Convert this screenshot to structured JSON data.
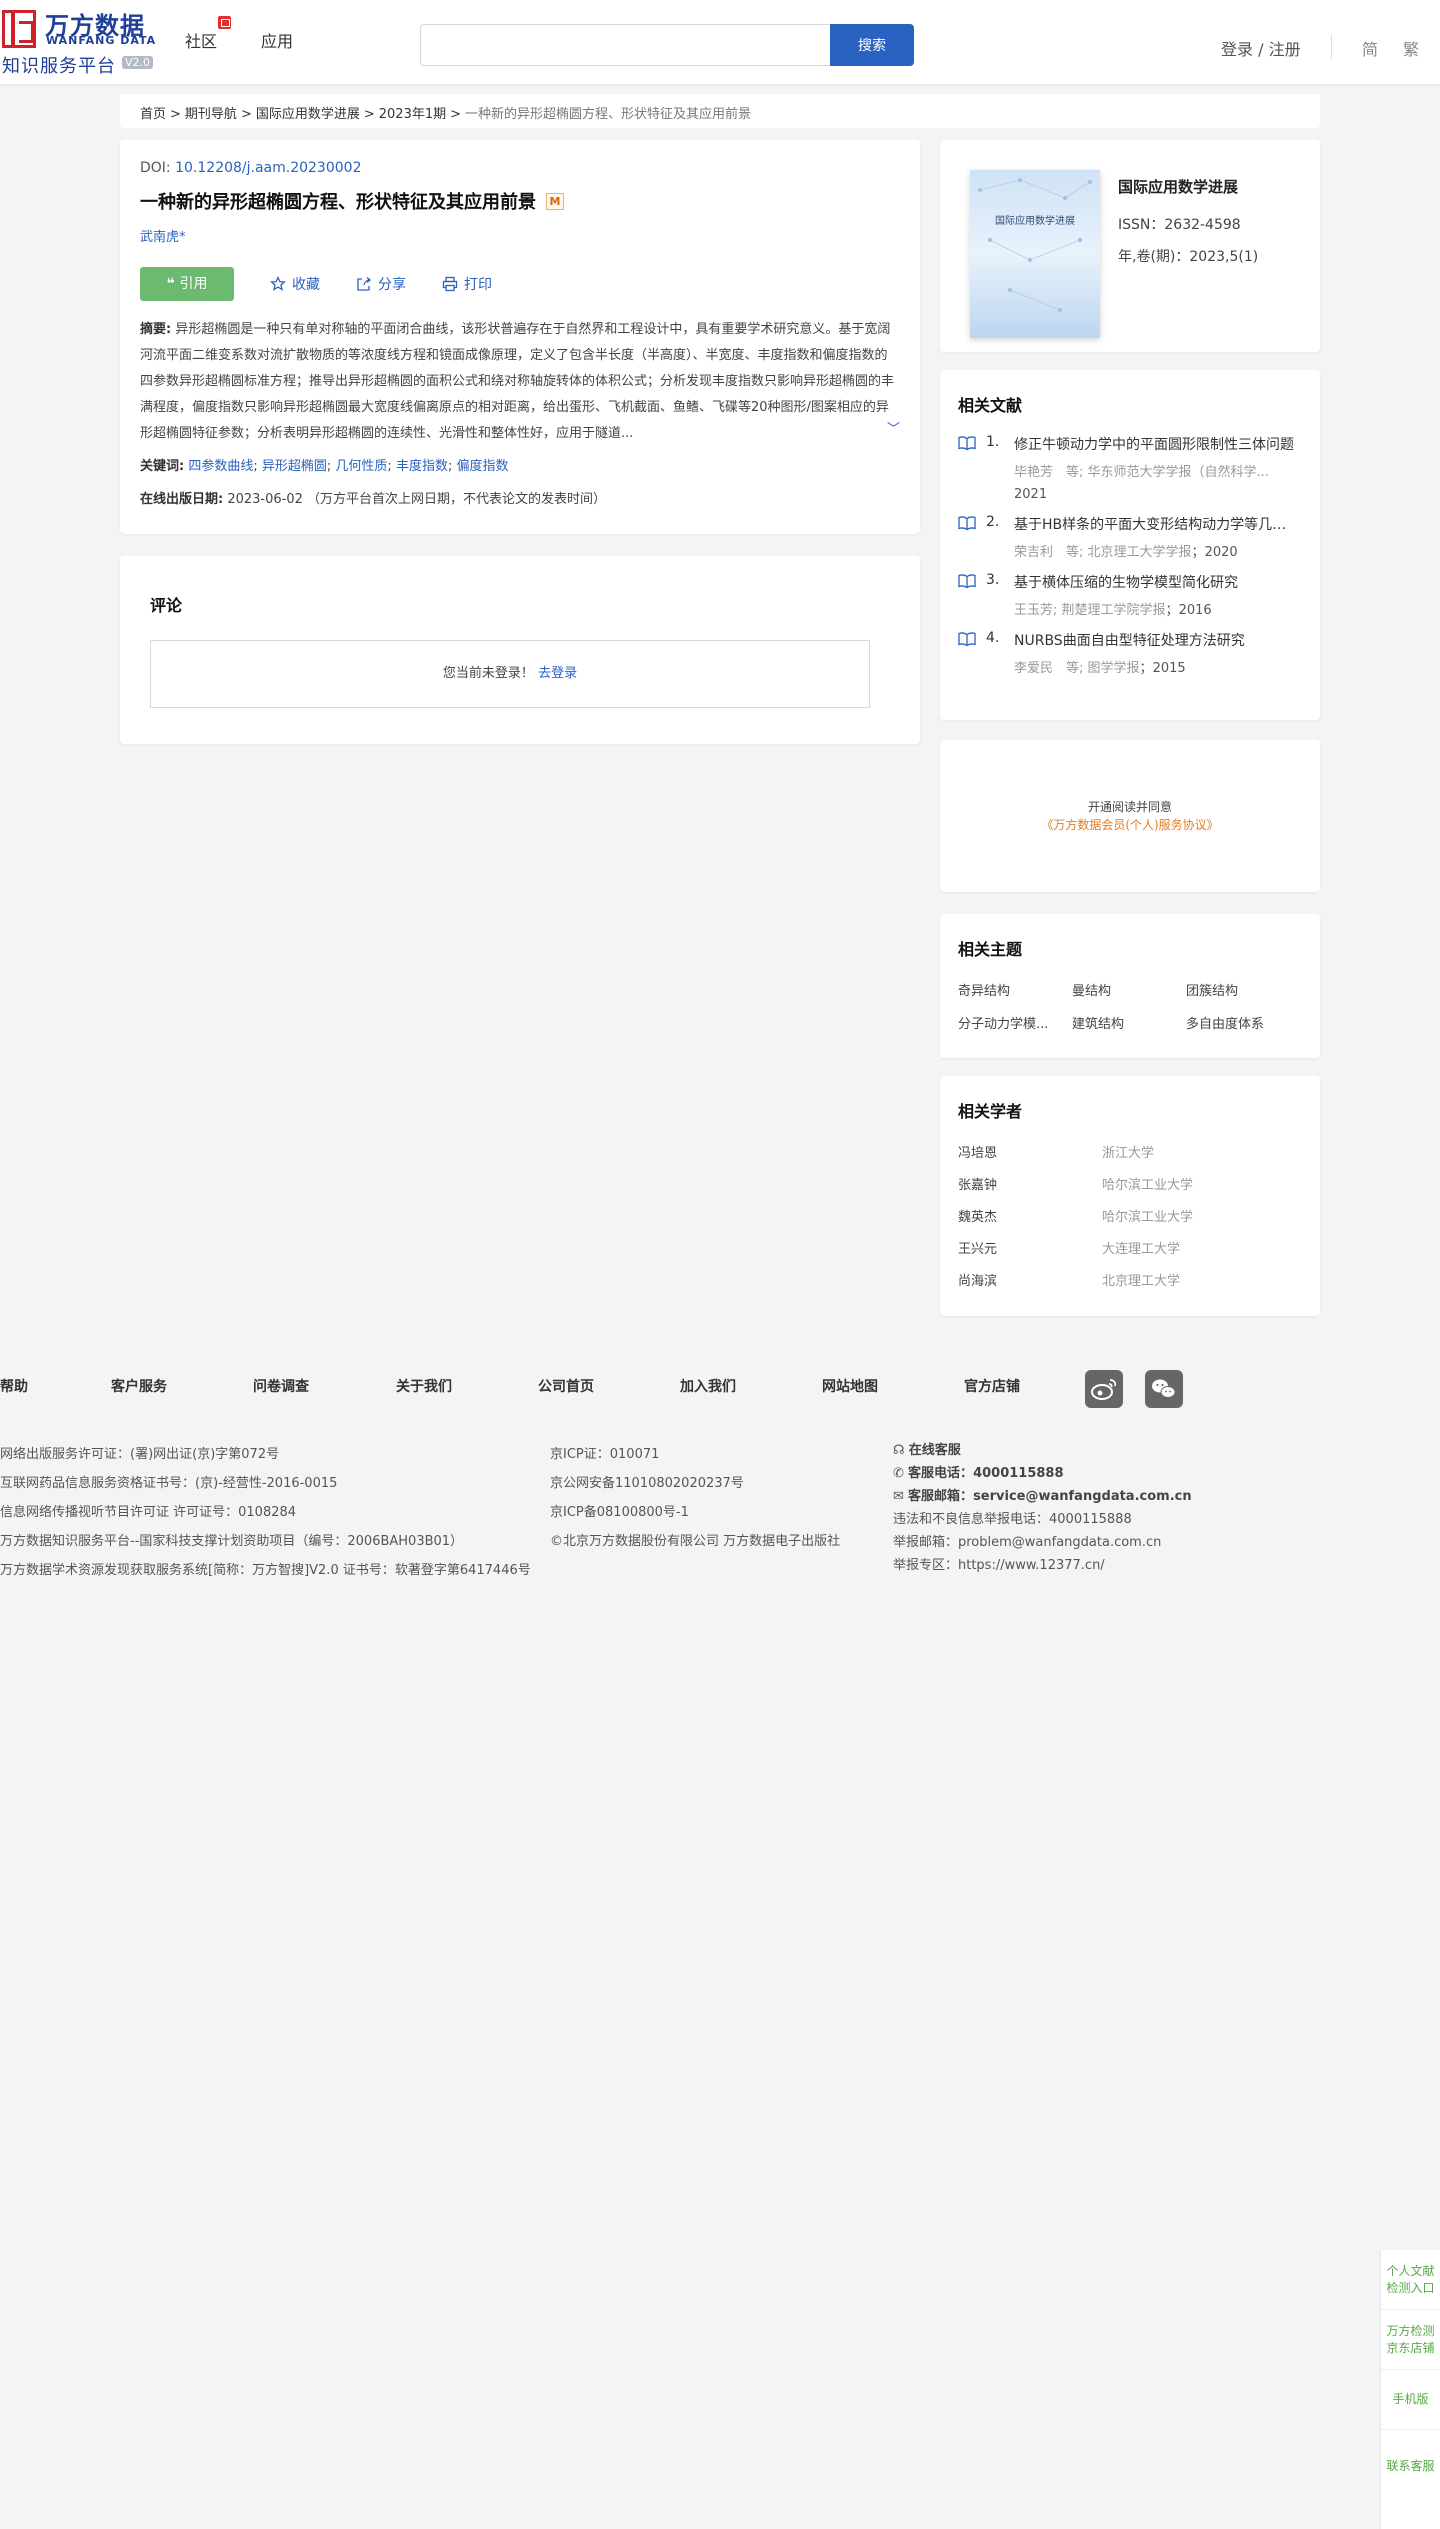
{
  "header": {
    "logo_cn": "万方数据",
    "logo_en": "WANFANG DATA",
    "logo_sub": "知识服务平台",
    "logo_ver": "V2.0",
    "nav": [
      "社区",
      "应用"
    ],
    "search_placeholder": "",
    "search_button": "搜索",
    "login": "登录 / 注册",
    "lang_simplified": "简",
    "lang_traditional": "繁"
  },
  "breadcrumb": [
    "首页",
    "期刊导航",
    "国际应用数学进展",
    "2023年1期",
    "一种新的异形超椭圆方程、形状特征及其应用前景"
  ],
  "article": {
    "doi_label": "DOI:",
    "doi": "10.12208/j.aam.20230002",
    "title": "一种新的异形超椭圆方程、形状特征及其应用前景",
    "badge": "M",
    "author": "武南虎*",
    "actions": {
      "cite": "引用",
      "favorite": "收藏",
      "share": "分享",
      "print": "打印"
    },
    "abstract_label": "摘要:",
    "abstract": "异形超椭圆是一种只有单对称轴的平面闭合曲线，该形状普遍存在于自然界和工程设计中，具有重要学术研究意义。基于宽阔河流平面二维变系数对流扩散物质的等浓度线方程和镜面成像原理，定义了包含半长度（半高度）、半宽度、丰度指数和偏度指数的四参数异形超椭圆标准方程；推导出异形超椭圆的面积公式和绕对称轴旋转体的体积公式；分析发现丰度指数只影响异形超椭圆的丰满程度，偏度指数只影响异形超椭圆最大宽度线偏离原点的相对距离，给出蛋形、飞机截面、鱼鳍、飞碟等20种图形/图案相应的异形超椭圆特征参数；分析表明异形超椭圆的连续性、光滑性和整体性好，应用于隧道...",
    "keywords_label": "关键词:",
    "keywords": [
      "四参数曲线",
      "异形超椭圆",
      "几何性质",
      "丰度指数",
      "偏度指数"
    ],
    "pubdate_label": "在线出版日期:",
    "pubdate": "2023-06-02 （万方平台首次上网日期，不代表论文的发表时间）"
  },
  "comments": {
    "title": "评论",
    "not_logged_in": "您当前未登录！",
    "login_link": "去登录"
  },
  "journal": {
    "cover_title": "国际应用数学进展",
    "name": "国际应用数学进展",
    "issn": "ISSN：2632-4598",
    "vol": "年,卷(期)：2023,5(1)"
  },
  "related_docs": {
    "title": "相关文献",
    "items": [
      {
        "no": "1.",
        "title": "修正牛顿动力学中的平面圆形限制性三体问题",
        "authors": "毕艳芳　等;",
        "source": "华东师范大学学报（自然科学...",
        "year": "2021"
      },
      {
        "no": "2.",
        "title": "基于HB样条的平面大变形结构动力学等几何...",
        "authors": "荣吉利　等;",
        "source": "北京理工大学学报",
        "year": "2020"
      },
      {
        "no": "3.",
        "title": "基于横体压缩的生物学模型简化研究",
        "authors": "王玉芳;",
        "source": "荆楚理工学院学报",
        "year": "2016"
      },
      {
        "no": "4.",
        "title": "NURBS曲面自由型特征处理方法研究",
        "authors": "李爱民　等;",
        "source": "图学学报",
        "year": "2015"
      }
    ]
  },
  "open_reading": {
    "line1": "开通阅读并同意",
    "line2": "《万方数据会员(个人)服务协议》"
  },
  "related_topics": {
    "title": "相关主题",
    "items": [
      "奇异结构",
      "曼结构",
      "团簇结构",
      "分子动力学模...",
      "建筑结构",
      "多自由度体系"
    ]
  },
  "related_scholars": {
    "title": "相关学者",
    "items": [
      {
        "name": "冯培恩",
        "org": "浙江大学"
      },
      {
        "name": "张嘉钟",
        "org": "哈尔滨工业大学"
      },
      {
        "name": "魏英杰",
        "org": "哈尔滨工业大学"
      },
      {
        "name": "王兴元",
        "org": "大连理工大学"
      },
      {
        "name": "尚海滨",
        "org": "北京理工大学"
      }
    ]
  },
  "footer": {
    "nav": [
      "帮助",
      "客户服务",
      "问卷调查",
      "关于我们",
      "公司首页",
      "加入我们",
      "网站地图",
      "官方店铺"
    ],
    "col1": [
      "网络出版服务许可证：(署)网出证(京)字第072号",
      "互联网药品信息服务资格证书号：(京)-经营性-2016-0015",
      "信息网络传播视听节目许可证 许可证号：0108284",
      "万方数据知识服务平台--国家科技支撑计划资助项目（编号：2006BAH03B01）",
      "万方数据学术资源发现获取服务系统[简称：万方智搜]V2.0 证书号：软著登字第6417446号"
    ],
    "col2": [
      "京ICP证：010071",
      "京公网安备11010802020237号",
      "京ICP备08100800号-1",
      "©北京万方数据股份有限公司 万方数据电子出版社"
    ],
    "col3": {
      "online_service": "在线客服",
      "phone_label": "客服电话：",
      "phone": "4000115888",
      "email_label": "客服邮箱：",
      "email": "service@wanfangdata.com.cn",
      "report_phone": "违法和不良信息举报电话：4000115888",
      "report_email": "举报邮箱：problem@wanfangdata.com.cn",
      "report_zone": "举报专区：https://www.12377.cn/"
    }
  },
  "side_float": [
    "个人文献检测入口",
    "万方检测京东店铺",
    "手机版",
    "联系客服"
  ]
}
